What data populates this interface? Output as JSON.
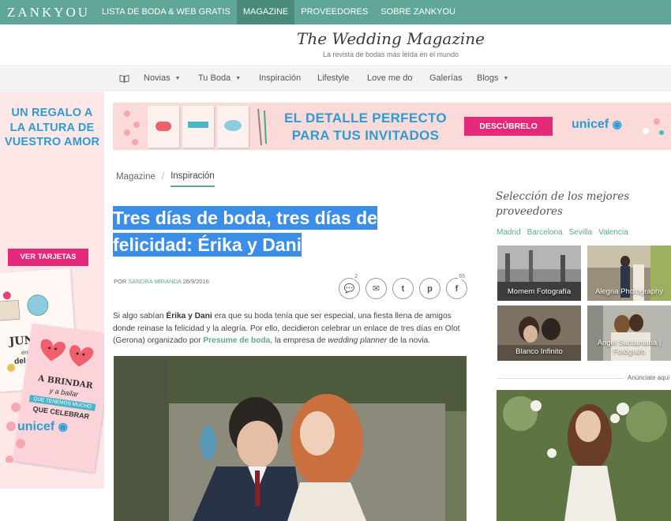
{
  "topbar": {
    "logo": "ZANKYOU",
    "nav": [
      {
        "label": "LISTA DE BODA & WEB GRATIS",
        "active": false
      },
      {
        "label": "MAGAZINE",
        "active": true
      },
      {
        "label": "PROVEEDORES",
        "active": false
      },
      {
        "label": "SOBRE ZANKYOU",
        "active": false
      }
    ]
  },
  "header": {
    "title": "The Wedding Magazine",
    "subtitle": "La revista de bodas más leída en el mundo"
  },
  "secnav": {
    "items": [
      "Novias",
      "Tu Boda",
      "Inspiración",
      "Lifestyle",
      "Love me do",
      "Galerías",
      "Blogs"
    ]
  },
  "left_ad": {
    "headline": [
      "UN REGALO A",
      "LA ALTURA DE",
      "VUESTRO AMOR"
    ],
    "cta": "VER TARJETAS",
    "card1_text": [
      "JUNTOS",
      "en el viaje",
      "del MUNDO"
    ],
    "card2_text": [
      "A BRINDAR",
      "y a bailar",
      "QUE TENEMOS MUCHO",
      "QUE CELEBRAR"
    ],
    "brand": "unicef"
  },
  "banner": {
    "line1": "EL DETALLE PERFECTO",
    "line2": "PARA TUS INVITADOS",
    "cta": "DESCÚBRELO",
    "brand": "unicef"
  },
  "breadcrumb": {
    "root": "Magazine",
    "current": "Inspiración"
  },
  "article": {
    "title": "Tres días de boda, tres días de felicidad: Érika y Dani",
    "by_prefix": "POR",
    "author": "SANDRA MIRANDA",
    "date": "26/9/2016",
    "share_counts": {
      "comments": "2",
      "facebook": "65"
    },
    "body": {
      "p1": "Si algo sabían ",
      "names": "Érika y Dani",
      "p2": " era que su boda tenía que ser especial, una fiesta llena de amigos donde reinase la felicidad y la alegría. Por ello, decidieron celebrar un enlace de tres días en Olot (Gerona) organizado por ",
      "link": "Presume de boda",
      "p3": ", la empresa de ",
      "em": "wedding planner",
      "p4": " de la novia."
    }
  },
  "sidebar": {
    "title": "Selección de los mejores proveedores",
    "cities": [
      "Madrid",
      "Barcelona",
      "Sevilla",
      "Valencia"
    ],
    "tiles": [
      {
        "label": "Momem Fotografía"
      },
      {
        "label": "Alegria Photography"
      },
      {
        "label": "Blanco Infinito"
      },
      {
        "label": "Angel Santamaria | Fotógrafo"
      }
    ],
    "ad_label": "Anúnciate aquí"
  },
  "colors": {
    "brand": "#60a697",
    "accent_pink": "#e6287a",
    "unicef_blue": "#2e9bd1",
    "highlight": "#3b8ee8"
  }
}
